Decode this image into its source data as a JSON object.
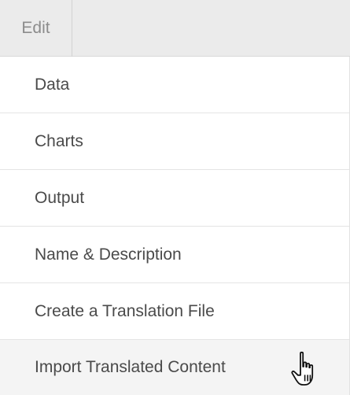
{
  "menubar": {
    "tab_label": "Edit"
  },
  "menu": {
    "items": [
      {
        "label": "Data"
      },
      {
        "label": "Charts"
      },
      {
        "label": "Output"
      },
      {
        "label": "Name & Description"
      },
      {
        "label": "Create a Translation File"
      },
      {
        "label": "Import Translated Content"
      }
    ]
  },
  "cursor": {
    "icon": "hand-pointer-icon"
  }
}
